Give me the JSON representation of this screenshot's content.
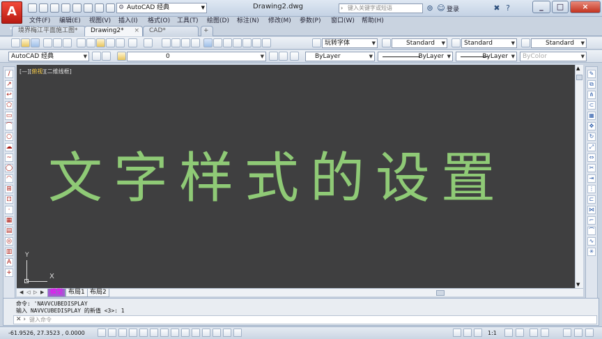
{
  "title_bar": {
    "app_logo": "A",
    "workspace": "AutoCAD 经典",
    "document_title": "Drawing2.dwg",
    "search_placeholder": "键入关键字或短语",
    "login_label": "登录",
    "window_buttons": [
      "_",
      "□",
      "×"
    ]
  },
  "menu": [
    "文件(F)",
    "编辑(E)",
    "视图(V)",
    "插入(I)",
    "格式(O)",
    "工具(T)",
    "绘图(D)",
    "标注(N)",
    "修改(M)",
    "参数(P)",
    "窗口(W)",
    "帮助(H)"
  ],
  "tabs": [
    {
      "label": "境界梅江平面施工图*",
      "active": false
    },
    {
      "label": "Drawing2*",
      "active": true
    },
    {
      "label": "CAD*",
      "active": false
    }
  ],
  "styles_toolbar": {
    "text_style": "玩转字体",
    "dim_style": "Standard",
    "table_style": "Standard",
    "mleader_style": "Standard"
  },
  "layers_toolbar": {
    "workspace": "AutoCAD 经典",
    "layer": "0",
    "color": "ByLayer",
    "linetype": "ByLayer",
    "lineweight": "ByLayer",
    "plotstyle": "ByColor"
  },
  "viewport_label": {
    "prefix": "[—][",
    "view": "俯视",
    "suffix": "][二维线框]"
  },
  "drawing_text": "文字样式的设置",
  "ucs": {
    "y": "Y",
    "x": "X"
  },
  "layout_tabs": [
    {
      "label": "模型",
      "active": true
    },
    {
      "label": "布局1",
      "active": false
    },
    {
      "label": "布局2",
      "active": false
    }
  ],
  "command": {
    "line1": "命令: 'NAVVCUBEDISPLAY",
    "line2": "输入 NAVVCUBEDISPLAY 的新值 <3>: 1",
    "input_placeholder": "键入命令"
  },
  "status": {
    "coords": "-61.9526,  27.3523 , 0.0000",
    "scale": "1:1"
  },
  "colors": {
    "canvas": "#3f3f40",
    "drawing_text": "#8fca76",
    "logo": "#d42a1e"
  }
}
